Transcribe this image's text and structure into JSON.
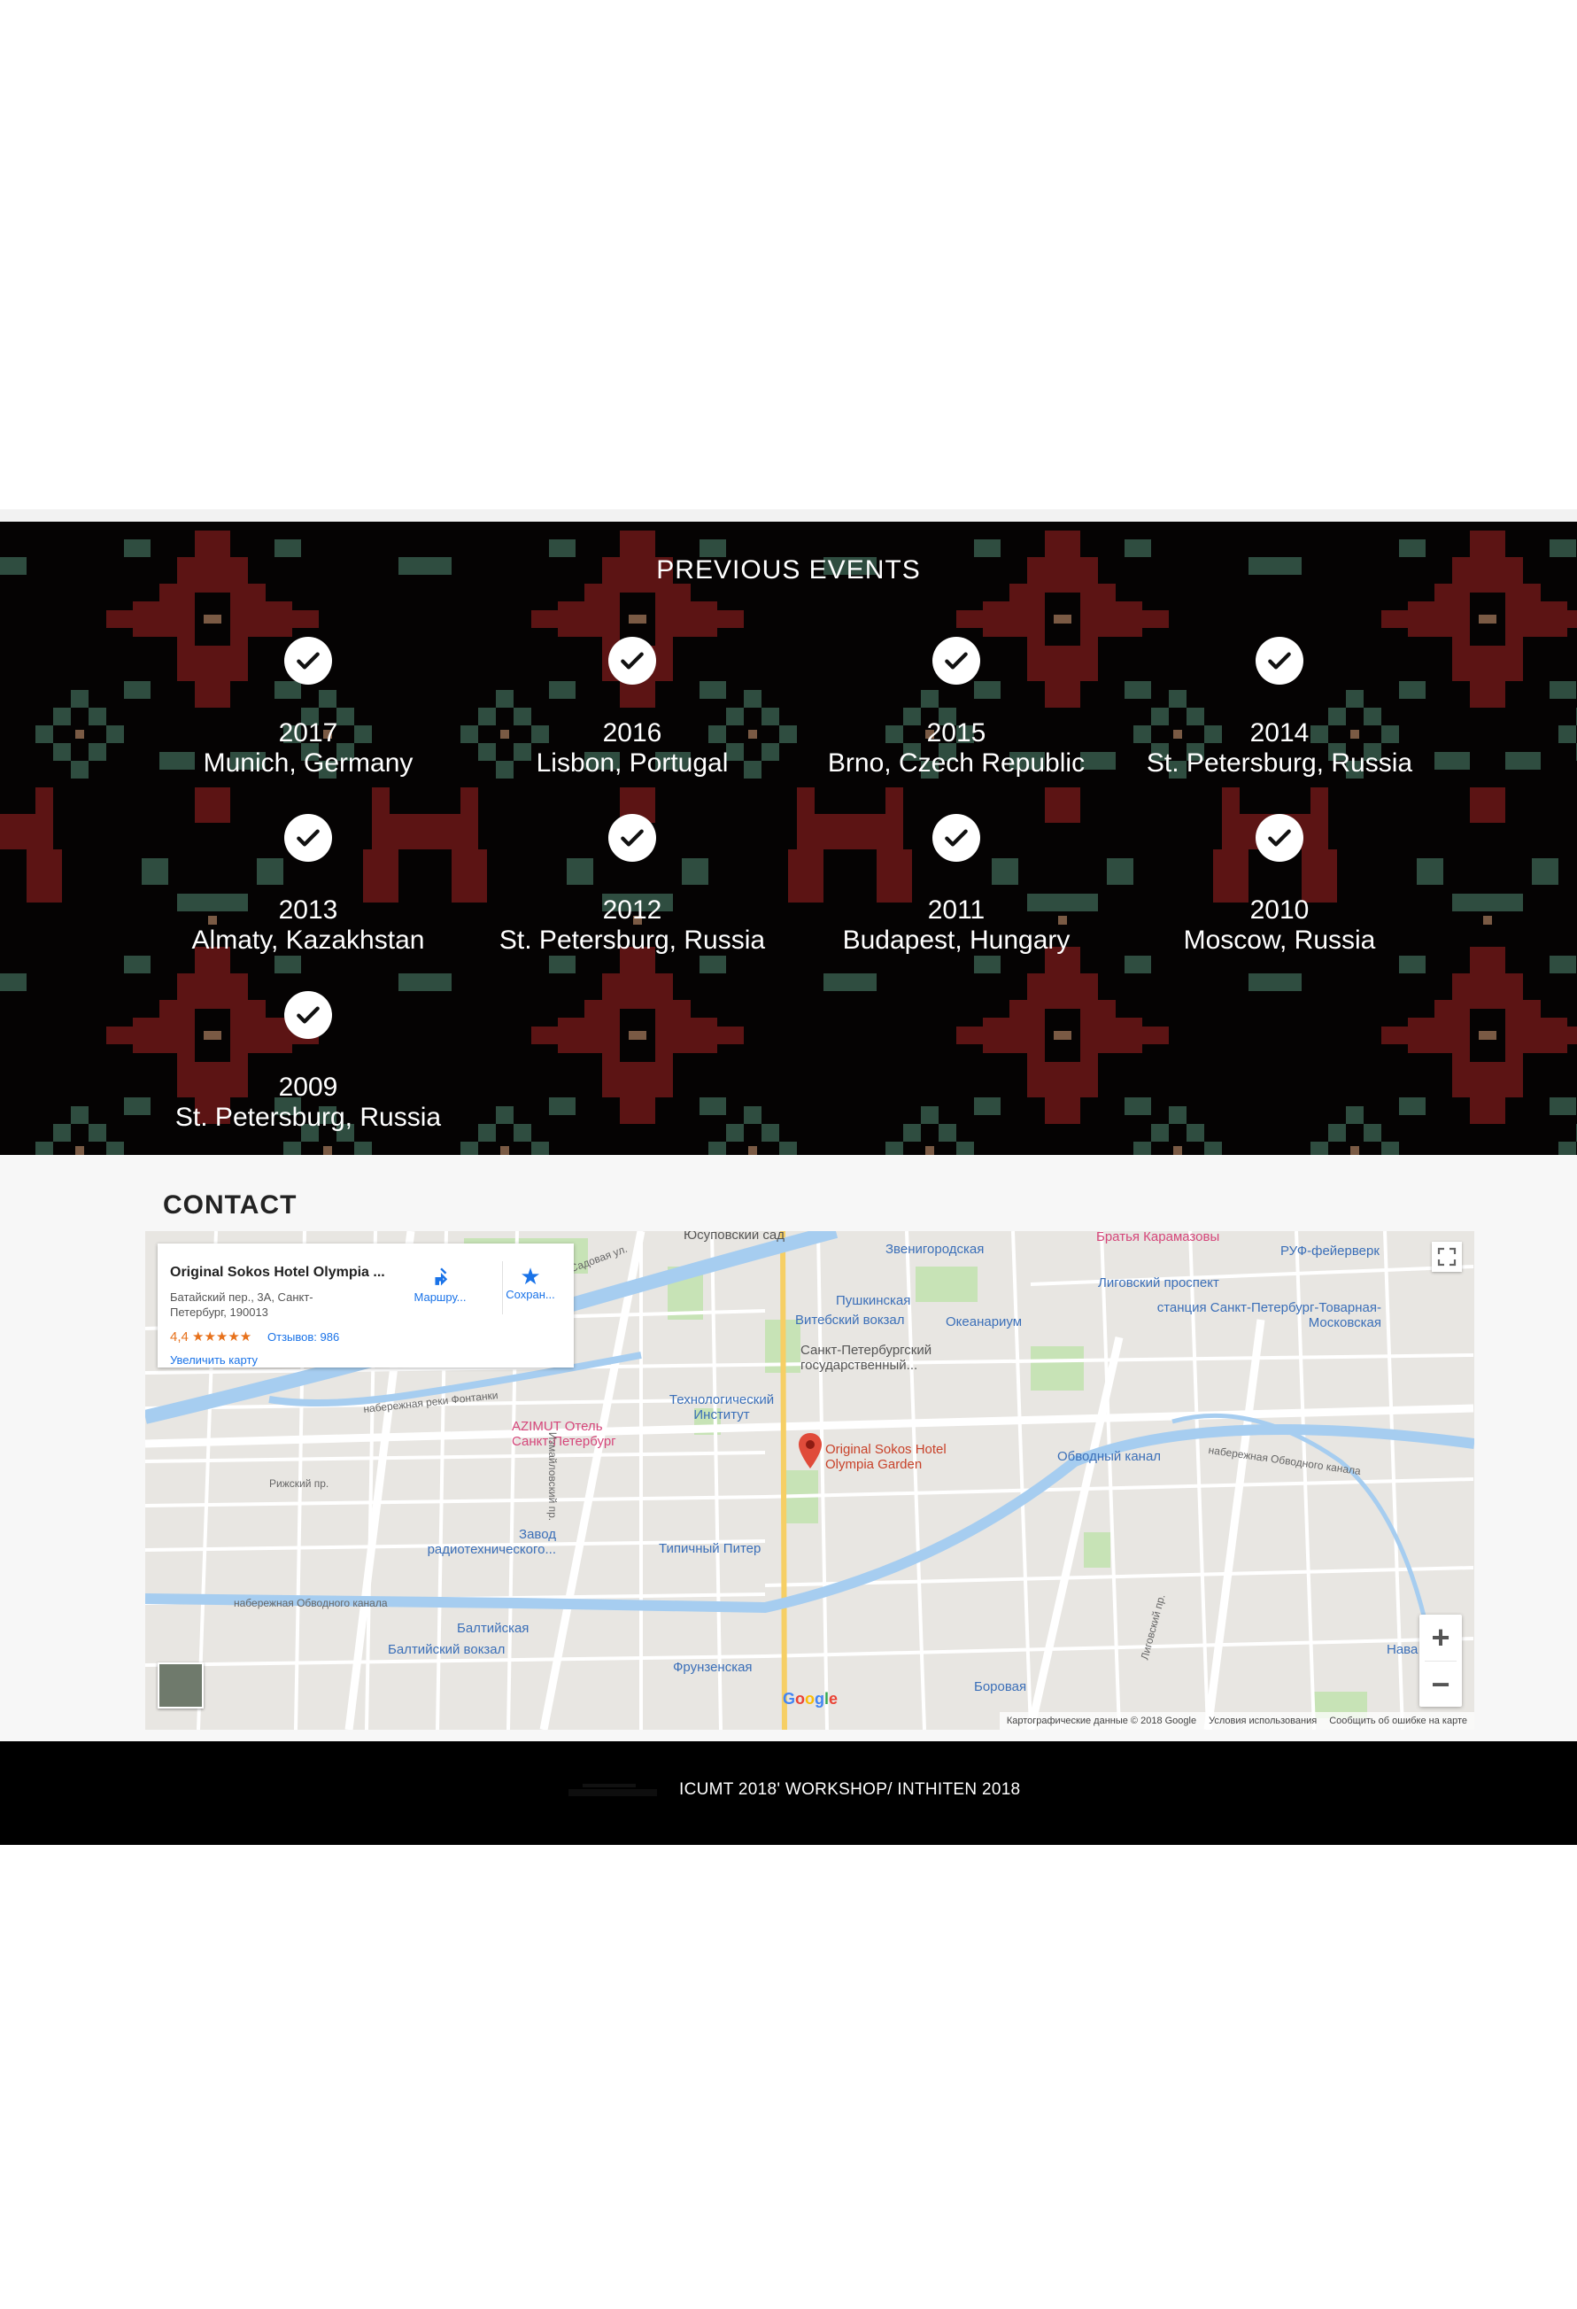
{
  "events": {
    "title": "PREVIOUS EVENTS",
    "items": [
      {
        "year": "2017",
        "place": "Munich, Germany"
      },
      {
        "year": "2016",
        "place": "Lisbon, Portugal"
      },
      {
        "year": "2015",
        "place": "Brno, Czech Republic"
      },
      {
        "year": "2014",
        "place": "St. Petersburg, Russia"
      },
      {
        "year": "2013",
        "place": "Almaty, Kazakhstan"
      },
      {
        "year": "2012",
        "place": "St. Petersburg, Russia"
      },
      {
        "year": "2011",
        "place": "Budapest, Hungary"
      },
      {
        "year": "2010",
        "place": "Moscow, Russia"
      },
      {
        "year": "2009",
        "place": "St. Petersburg, Russia"
      }
    ],
    "icon": "check-circle-icon",
    "colors": {
      "pattern_red": "#5c1414",
      "pattern_green": "#2f4d40",
      "pattern_bg": "#050303"
    }
  },
  "contact": {
    "title": "CONTACT",
    "map": {
      "card": {
        "title": "Original Sokos Hotel Olympia ...",
        "address": "Батайский пер., 3А, Санкт-Петербург, 190013",
        "rating": "4,4 ★★★★★",
        "reviews": "Отзывов: 986",
        "zoom_link": "Увеличить карту",
        "directions": "Маршру...",
        "save": "Сохран..."
      },
      "pin_label": "Original Sokos Hotel Olympia Garden",
      "labels": {
        "yusupov": "Юсуповский сад",
        "zvenigorodskaya": "Звенигородская",
        "bratya": "Братья Карамазовы",
        "ruf": "РУФ-фейерверк",
        "pushkinskaya": "Пушкинская",
        "vitebsky": "Витебский вокзал",
        "oceanarium": "Океанариум",
        "ligovsky": "Лиговский проспект",
        "station": "станция Санкт-Петербург-Товарная-Московская",
        "spbgu": "Санкт-Петербургский государственный...",
        "techinst": "Технологический Институт",
        "azimut": "AZIMUT Отель Санкт-Петербург",
        "obvodny": "Обводный канал",
        "zavod": "Завод радиотехнического...",
        "tipichny": "Типичный Питер",
        "baltiyskaya": "Балтийская",
        "baltiysky_vokzal": "Балтийский вокзал",
        "frunzenskaya": "Фрунзенская",
        "borovaya": "Боровая",
        "nava": "Нава",
        "nab_fontanki": "набережная реки Фонтанки",
        "nab_obvodnogo": "набережная Обводного канала",
        "izmailovsky": "Измайловский пр.",
        "rizhsky": "Рижский пр.",
        "ligovsky_pr": "Лиговский пр.",
        "sadovaya": "Садовая ул."
      },
      "attribution": [
        "Картографические данные © 2018 Google",
        "Условия использования",
        "Сообщить об ошибке на карте"
      ],
      "google": "Google",
      "zoom_in": "+",
      "zoom_out": "−"
    }
  },
  "footer": {
    "text": "ICUMT 2018' WORKSHOP/ INTHITEN 2018"
  }
}
